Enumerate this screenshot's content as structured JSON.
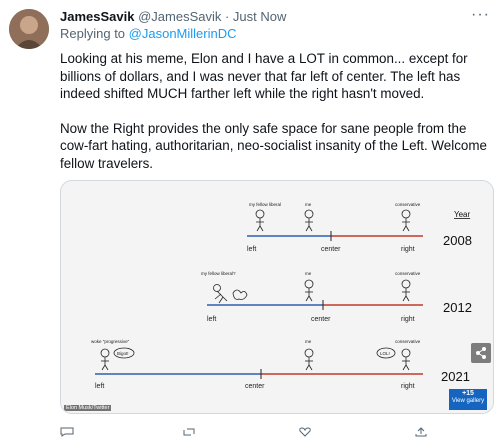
{
  "tweet": {
    "author_name": "JamesSavik",
    "handle": "@JamesSavik",
    "separator": " · ",
    "timestamp": "Just Now",
    "replying_prefix": "Replying to ",
    "replying_to": "@JasonMillerinDC",
    "more_label": "···",
    "paragraph1": "Looking at his meme, Elon and I have a LOT in common... except for billions of dollars, and I was never that far left of center. The left has indeed shifted MUCH farther left while the right hasn't moved.",
    "paragraph2": "Now the Right provides the only safe space for sane people from the cow-fart hating, authoritarian, neo-socialist insanity of the Left. Welcome fellow travelers."
  },
  "meme": {
    "year_header": "Year",
    "rows": [
      {
        "year": "2008",
        "left": "left",
        "center": "center",
        "right": "right",
        "labels": [
          "my fellow liberal",
          "me",
          "conservative"
        ]
      },
      {
        "year": "2012",
        "left": "left",
        "center": "center",
        "right": "right",
        "labels": [
          "my fellow liberal?",
          "me",
          "conservative"
        ]
      },
      {
        "year": "2021",
        "left": "left",
        "center": "center",
        "right": "right",
        "labels": [
          "woke \"progressive\"",
          "me",
          "conservative"
        ],
        "bubbles": [
          "Bigot!",
          "LOL!"
        ]
      }
    ],
    "credit": "Elon Musk/Twitter",
    "gallery_count": "+15",
    "gallery_label": "View gallery",
    "colors": {
      "left_line": "#2f5fb0",
      "right_line": "#c0392b",
      "gallery": "#1565c0"
    }
  },
  "actions": [
    "reply-icon",
    "retweet-icon",
    "like-icon",
    "share-icon"
  ]
}
